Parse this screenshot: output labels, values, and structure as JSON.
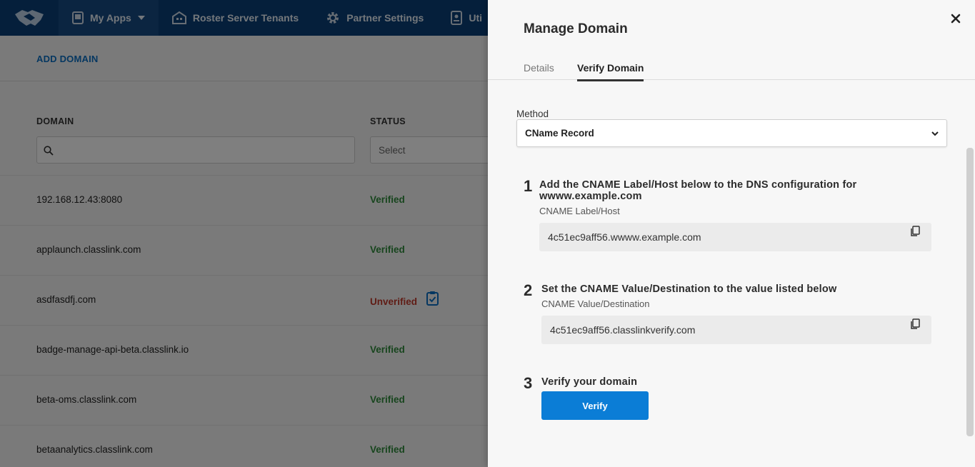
{
  "nav": {
    "items": [
      {
        "label": "My Apps",
        "icon": "apps-icon"
      },
      {
        "label": "Roster Server Tenants",
        "icon": "building-icon"
      },
      {
        "label": "Partner Settings",
        "icon": "gear-icon"
      },
      {
        "label": "Uti",
        "icon": "badge-icon"
      }
    ]
  },
  "toolbar": {
    "add_domain": "ADD DOMAIN"
  },
  "table": {
    "headers": {
      "domain": "DOMAIN",
      "status": "STATUS"
    },
    "status_placeholder": "Select",
    "rows": [
      {
        "domain": "192.168.12.43:8080",
        "status": "Verified"
      },
      {
        "domain": "applaunch.classlink.com",
        "status": "Verified"
      },
      {
        "domain": "asdfasdfj.com",
        "status": "Unverified"
      },
      {
        "domain": "badge-manage-api-beta.classlink.io",
        "status": "Verified"
      },
      {
        "domain": "beta-oms.classlink.com",
        "status": "Verified"
      },
      {
        "domain": "betaanalytics.classlink.com",
        "status": "Verified"
      }
    ]
  },
  "panel": {
    "title": "Manage Domain",
    "close": "×",
    "tabs": {
      "details": "Details",
      "verify": "Verify Domain"
    },
    "method_label": "Method",
    "method_value": "CName Record",
    "steps": {
      "s1": {
        "num": "1",
        "title": "Add the CNAME Label/Host below to the DNS configuration for wwww.example.com",
        "field_label": "CNAME Label/Host",
        "value": "4c51ec9aff56.wwww.example.com"
      },
      "s2": {
        "num": "2",
        "title": "Set the CNAME Value/Destination to the value listed below",
        "field_label": "CNAME Value/Destination",
        "value": "4c51ec9aff56.classlinkverify.com"
      },
      "s3": {
        "num": "3",
        "title": "Verify your domain",
        "button": "Verify"
      }
    }
  },
  "colors": {
    "nav_bg": "#0a3f77",
    "accent": "#0b7dd6",
    "verified": "#2e8a3b",
    "unverified": "#c0392b"
  }
}
